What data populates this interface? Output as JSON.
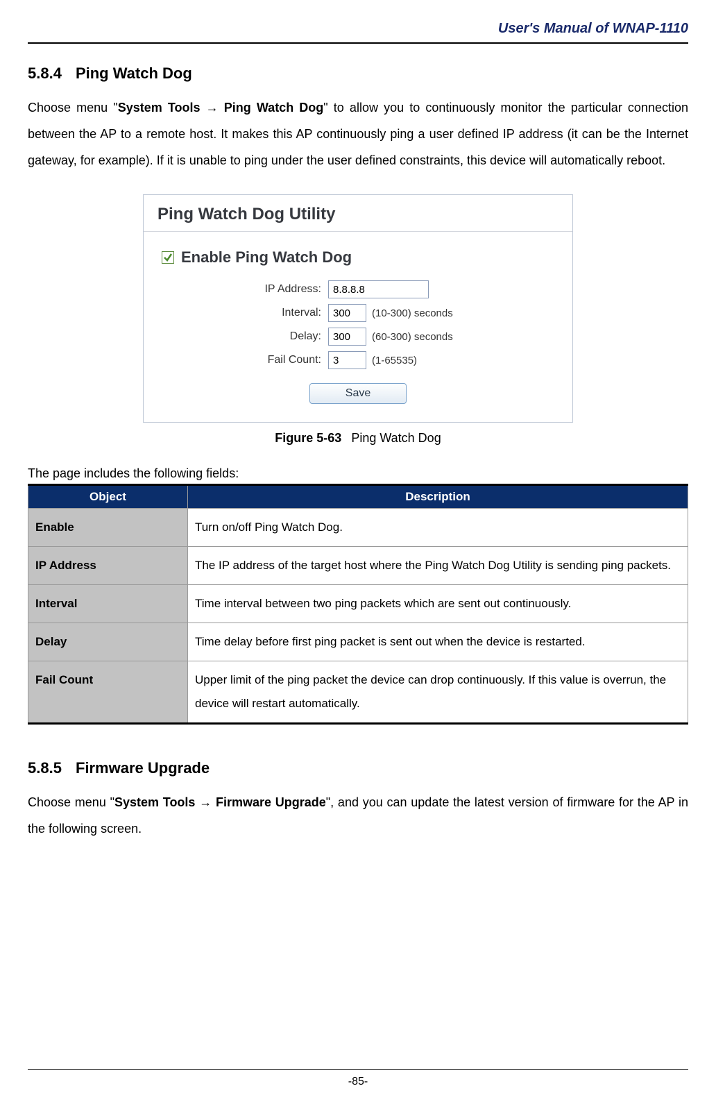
{
  "header": {
    "doc_title": "User's Manual of WNAP-1110"
  },
  "section1": {
    "num": "5.8.4",
    "title": "Ping Watch Dog",
    "intro_pre": "Choose menu \"",
    "intro_bold": "System Tools → Ping Watch Dog",
    "intro_post": "\" to allow you to continuously monitor the particular connection between the AP to a remote host. It makes this AP continuously ping a user defined IP address (it can be the Internet gateway, for example). If it is unable to ping under the user defined constraints, this device will automatically reboot."
  },
  "figure": {
    "panel_title": "Ping Watch Dog Utility",
    "enable_label": "Enable Ping Watch Dog",
    "rows": {
      "ip_label": "IP Address:",
      "ip_value": "8.8.8.8",
      "interval_label": "Interval:",
      "interval_value": "300",
      "interval_suffix": "(10-300) seconds",
      "delay_label": "Delay:",
      "delay_value": "300",
      "delay_suffix": "(60-300) seconds",
      "fail_label": "Fail Count:",
      "fail_value": "3",
      "fail_suffix": "(1-65535)"
    },
    "save_label": "Save",
    "caption_bold": "Figure 5-63",
    "caption_text": "Ping Watch Dog"
  },
  "fields": {
    "intro": "The page includes the following fields:",
    "headers": {
      "object": "Object",
      "description": "Description"
    },
    "rows": [
      {
        "object": "Enable",
        "description": "Turn on/off Ping Watch Dog."
      },
      {
        "object": "IP Address",
        "description": "The IP address of the target host where the Ping Watch Dog Utility is sending ping packets."
      },
      {
        "object": "Interval",
        "description": "Time interval between two ping packets which are sent out continuously."
      },
      {
        "object": "Delay",
        "description": "Time delay before first ping packet is sent out when the device is restarted."
      },
      {
        "object": "Fail Count",
        "description": "Upper limit of the ping packet the device can drop continuously. If this value is overrun, the device will restart automatically."
      }
    ]
  },
  "section2": {
    "num": "5.8.5",
    "title": "Firmware Upgrade",
    "intro_pre": "Choose menu \"",
    "intro_bold": "System Tools → Firmware Upgrade",
    "intro_post": "\", and you can update the latest version of firmware for the AP in the following screen."
  },
  "footer": {
    "page": "-85-"
  }
}
